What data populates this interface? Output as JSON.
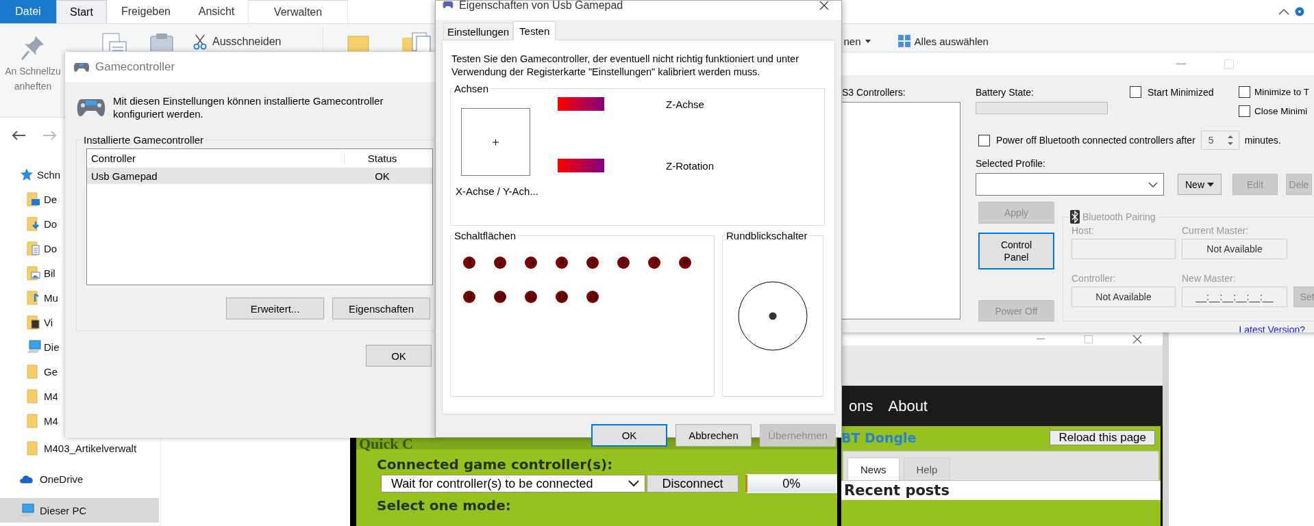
{
  "explorer": {
    "ribbon_tabs": [
      {
        "label": "Datei",
        "kind": "file",
        "selected": false
      },
      {
        "label": "Start",
        "kind": "normal",
        "selected": true
      },
      {
        "label": "Freigeben",
        "kind": "normal",
        "selected": false
      },
      {
        "label": "Ansicht",
        "kind": "normal",
        "selected": false
      },
      {
        "label": "Verwalten",
        "kind": "contextual",
        "selected": false
      }
    ],
    "pin_label_lines": [
      "An Schnellzu",
      "anheften"
    ],
    "cut_label": "Ausschneiden",
    "open_label_fragment": "nen",
    "select_all_label": "Alles auswählen",
    "nav_items": [
      {
        "label": "Schn",
        "kind": "star",
        "selected": false
      },
      {
        "label": "De",
        "kind": "desktop",
        "selected": false
      },
      {
        "label": "Do",
        "kind": "download",
        "selected": false
      },
      {
        "label": "Do",
        "kind": "documents",
        "selected": false
      },
      {
        "label": "Bil",
        "kind": "pictures",
        "selected": false
      },
      {
        "label": "Mu",
        "kind": "music",
        "selected": false
      },
      {
        "label": "Vi",
        "kind": "videos",
        "selected": false
      },
      {
        "label": "Die",
        "kind": "pc",
        "selected": false
      },
      {
        "label": "Ge",
        "kind": "folder",
        "selected": false
      },
      {
        "label": "M4",
        "kind": "folder",
        "selected": false
      },
      {
        "label": "M4",
        "kind": "folder",
        "selected": false
      },
      {
        "label": "M403_Artikelverwalt",
        "kind": "folder",
        "selected": false
      },
      {
        "label": "OneDrive",
        "kind": "cloud",
        "selected": false
      },
      {
        "label": "Dieser PC",
        "kind": "pc",
        "selected": true
      }
    ]
  },
  "browser": {
    "nav_links": [
      "ons",
      "About"
    ],
    "header_fragment": "Quick C",
    "title_fragment": "BT Dongle",
    "reload_button": "Reload this page",
    "connected_label": "Connected game controller(s):",
    "controller_select": "Wait for controller(s) to be connected",
    "disconnect_button": "Disconnect",
    "progress": {
      "text": "0%",
      "level": 0
    },
    "mode_label": "Select one mode:",
    "side_tabs": [
      {
        "label": "News",
        "selected": true
      },
      {
        "label": "Help",
        "selected": false
      }
    ],
    "recent_posts": "Recent posts"
  },
  "gamecontroller": {
    "title": "Gamecontroller",
    "description": "Mit diesen Einstellungen können installierte Gamecontroller konfiguriert werden.",
    "group_label": "Installierte Gamecontroller",
    "columns": [
      "Controller",
      "Status"
    ],
    "rows": [
      {
        "controller": "Usb Gamepad",
        "status": "OK",
        "selected": true
      }
    ],
    "buttons": [
      "Erweitert...",
      "Eigenschaften"
    ],
    "ok_button": "OK"
  },
  "scp": {
    "controllers_label": "S3 Controllers:",
    "battery_label": "Battery State:",
    "checkboxes": [
      {
        "label": "Start Minimized",
        "checked": false
      },
      {
        "label": "Minimize to T",
        "checked": false
      },
      {
        "label": "Close Minimi",
        "checked": false
      }
    ],
    "power_off": {
      "label": "Power off Bluetooth connected controllers after",
      "checked": false,
      "value": "5",
      "unit": "minutes."
    },
    "profile_label": "Selected Profile:",
    "profile_buttons": [
      {
        "label": "New",
        "disabled": false,
        "caret": true
      },
      {
        "label": "Edit",
        "disabled": true,
        "caret": false
      },
      {
        "label": "Dele",
        "disabled": true,
        "caret": false
      }
    ],
    "side_buttons": [
      {
        "label": "Apply",
        "disabled": true,
        "focused": false
      },
      {
        "label": "Control Panel",
        "disabled": false,
        "focused": true
      },
      {
        "label": "Power Off",
        "disabled": true,
        "focused": false
      }
    ],
    "pairing": {
      "label": "Bluetooth Pairing",
      "host_label": "Host:",
      "current_master_label": "Current Master:",
      "current_master_value": "Not Available",
      "controller_label": "Controller:",
      "controller_value": "Not Available",
      "new_master_label": "New Master:",
      "new_master_value": "__:__:__:__:__:__",
      "set_button": "Set"
    },
    "latest_link": "Latest Version?"
  },
  "properties": {
    "title": "Eigenschaften von Usb Gamepad",
    "tabs": [
      {
        "label": "Einstellungen",
        "selected": false
      },
      {
        "label": "Testen",
        "selected": true
      }
    ],
    "description": "Testen Sie den Gamecontroller, der eventuell nicht richtig funktioniert und unter Verwendung der Registerkarte \"Einstellungen\" kalibriert werden muss.",
    "axes_label": "Achsen",
    "xy_label": "X-Achse / Y-Ach...",
    "axis_bars": [
      "Z-Achse",
      "Z-Rotation"
    ],
    "buttons_label": "Schaltflächen",
    "button_indicators": [
      "1",
      "2",
      "3",
      "4",
      "5",
      "6",
      "7",
      "8",
      "9",
      "10",
      "11",
      "12",
      "13"
    ],
    "pov_label": "Rundblickschalter",
    "dialog_buttons": [
      {
        "label": "OK",
        "disabled": false,
        "focused": true
      },
      {
        "label": "Abbrechen",
        "disabled": false,
        "focused": false
      },
      {
        "label": "Übernehmen",
        "disabled": true,
        "focused": false
      }
    ]
  }
}
